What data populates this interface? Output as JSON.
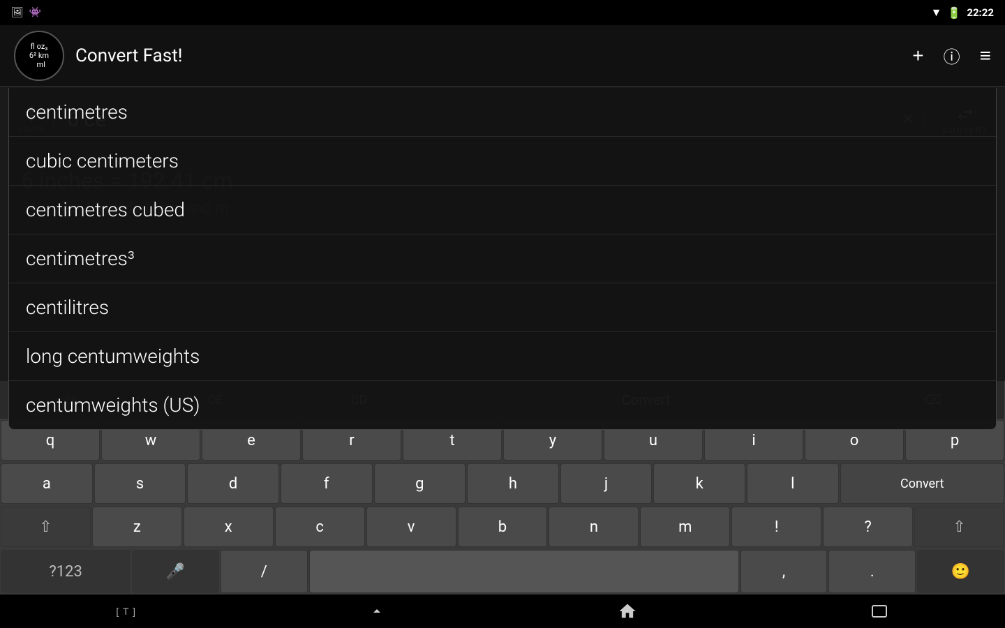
{
  "statusBar": {
    "time": "22:22",
    "wifiIcon": "▼",
    "batteryIcon": "🔋"
  },
  "appBar": {
    "logoText": "fl oz₃\n6² km\n  ml",
    "title": "Convert Fast!",
    "addBtn": "+",
    "infoBtn": "ⓘ",
    "menuBtn": "≡"
  },
  "searchArea": {
    "voiceLabel": "VOICE",
    "inputValue": "6 ce",
    "clearBtn": "✕",
    "convertLabel": "CONVERT"
  },
  "autocomplete": {
    "items": [
      "centimetres",
      "cubic centimeters",
      "centimetres cubed",
      "centimetres³",
      "centilitres",
      "long centumweights",
      "centumweights (US)"
    ]
  },
  "bgContent": {
    "conversionText": "6 inches = 192.41 cm",
    "secondaryText": "36 miles 45 yards in km and m"
  },
  "keyboard": {
    "specialRow": [
      "ce",
      "CE",
      "CD"
    ],
    "row1": [
      "q",
      "w",
      "e",
      "r",
      "t",
      "y",
      "u",
      "i",
      "o",
      "p"
    ],
    "row2": [
      "a",
      "s",
      "d",
      "f",
      "g",
      "h",
      "j",
      "k",
      "l"
    ],
    "row3": [
      "z",
      "x",
      "c",
      "v",
      "b",
      "n",
      "m",
      "!",
      "?"
    ],
    "row4": [
      "?123",
      "mic",
      "/",
      "space",
      ",",
      ".",
      "emoji"
    ],
    "convertKey": "Convert",
    "backspaceKey": "⌫",
    "shiftKey": "⇧"
  },
  "navBar": {
    "leftBtn": "[ T ]",
    "homeBtn": "⌂",
    "recentsBtn": "▭"
  }
}
